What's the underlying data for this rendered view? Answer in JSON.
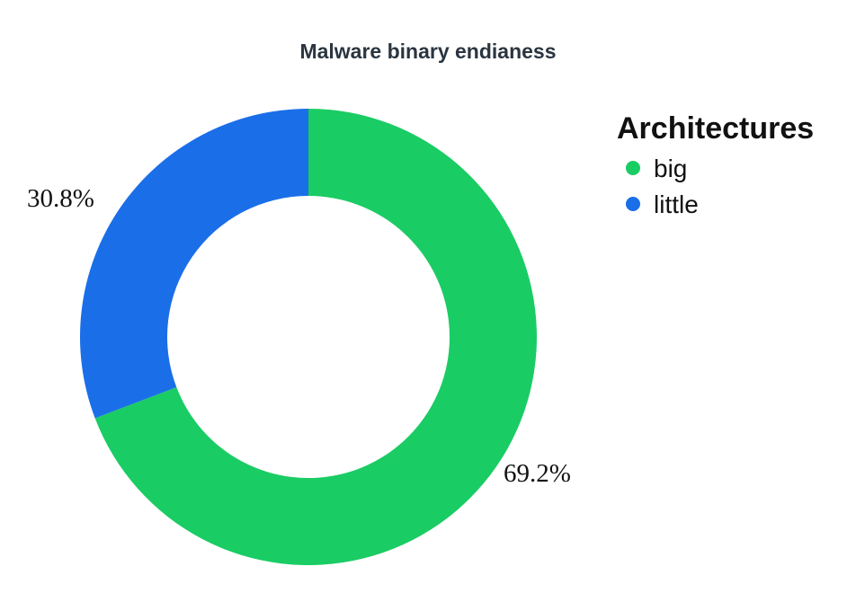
{
  "chart_data": {
    "type": "pie",
    "subtype": "donut",
    "title": "Malware binary endianess",
    "legend_title": "Architectures",
    "legend_position": "right",
    "categories": [
      "big",
      "little"
    ],
    "values": [
      69.2,
      30.8
    ],
    "labels": [
      "69.2%",
      "30.8%"
    ],
    "colors": [
      "#1acc64",
      "#1a6fe8"
    ]
  }
}
